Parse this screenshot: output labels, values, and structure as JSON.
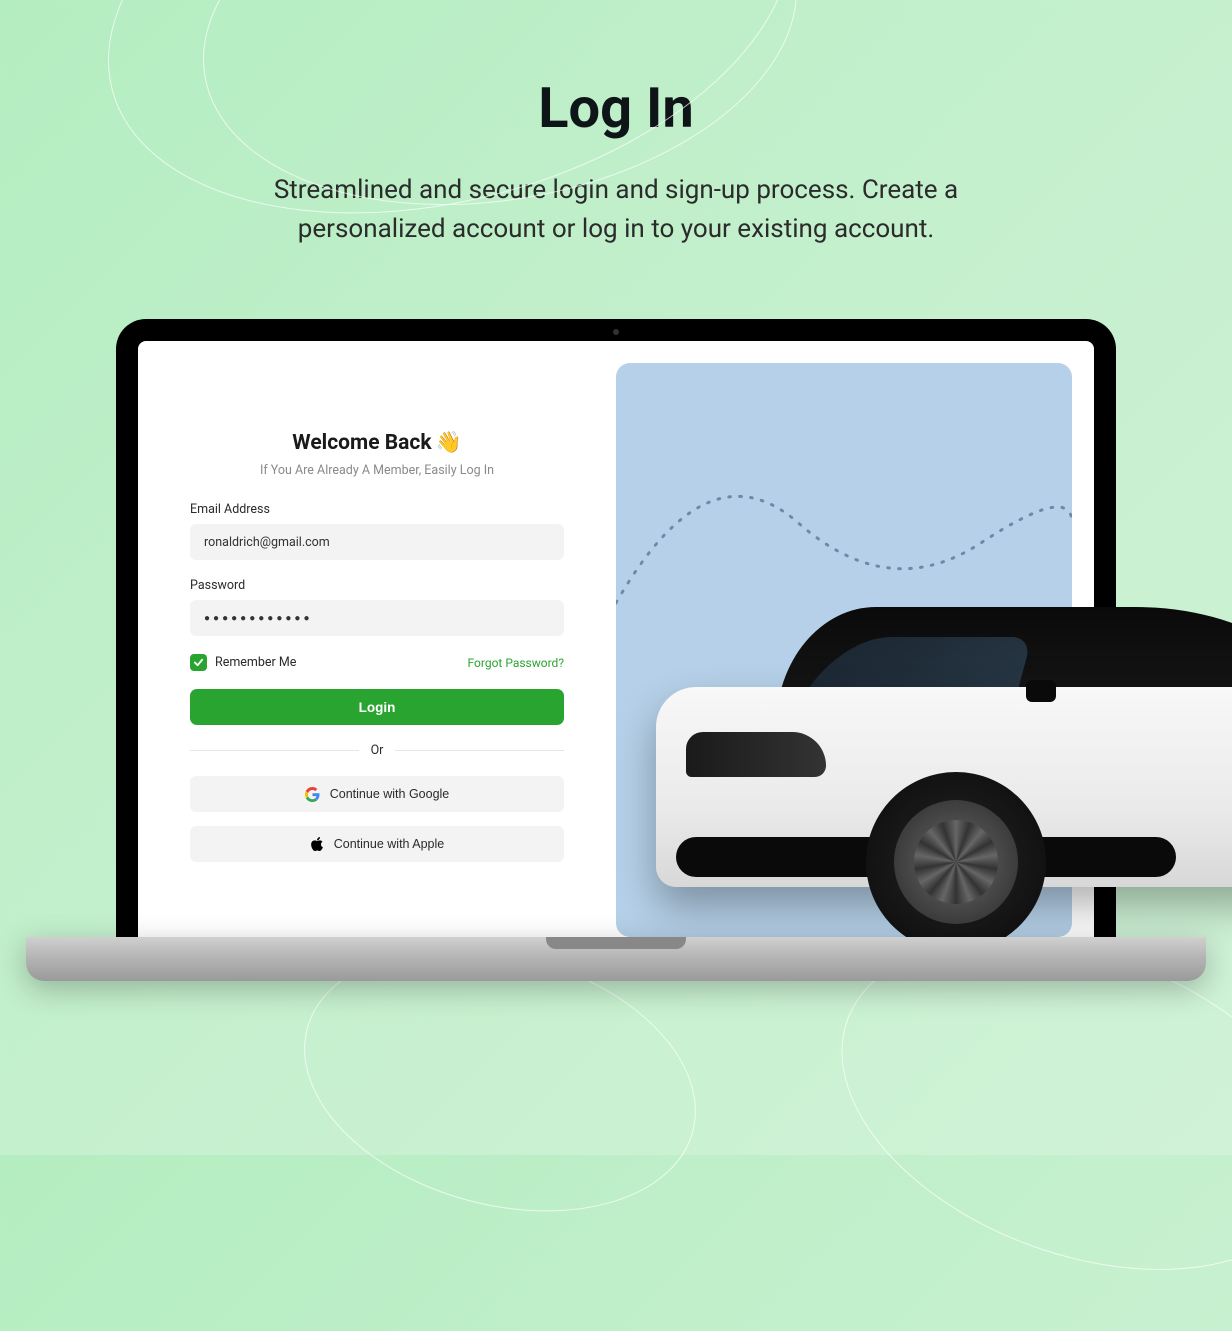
{
  "hero": {
    "title": "Log In",
    "subtitle": "Streamlined and secure login and sign-up process. Create a personalized account or log in to your existing account."
  },
  "login": {
    "welcome": "Welcome Back",
    "wave_emoji": "👋",
    "subtitle": "If You Are Already A Member, Easily Log In",
    "email_label": "Email Address",
    "email_value": "ronaldrich@gmail.com",
    "password_label": "Password",
    "password_value": "●●●●●●●●●●●●",
    "remember_label": "Remember Me",
    "remember_checked": true,
    "forgot_label": "Forgot Password?",
    "login_button": "Login",
    "divider": "Or",
    "google_button": "Continue with Google",
    "apple_button": "Continue with Apple"
  },
  "colors": {
    "accent": "#2aa430",
    "bg_panel": "#b5d0e8"
  }
}
